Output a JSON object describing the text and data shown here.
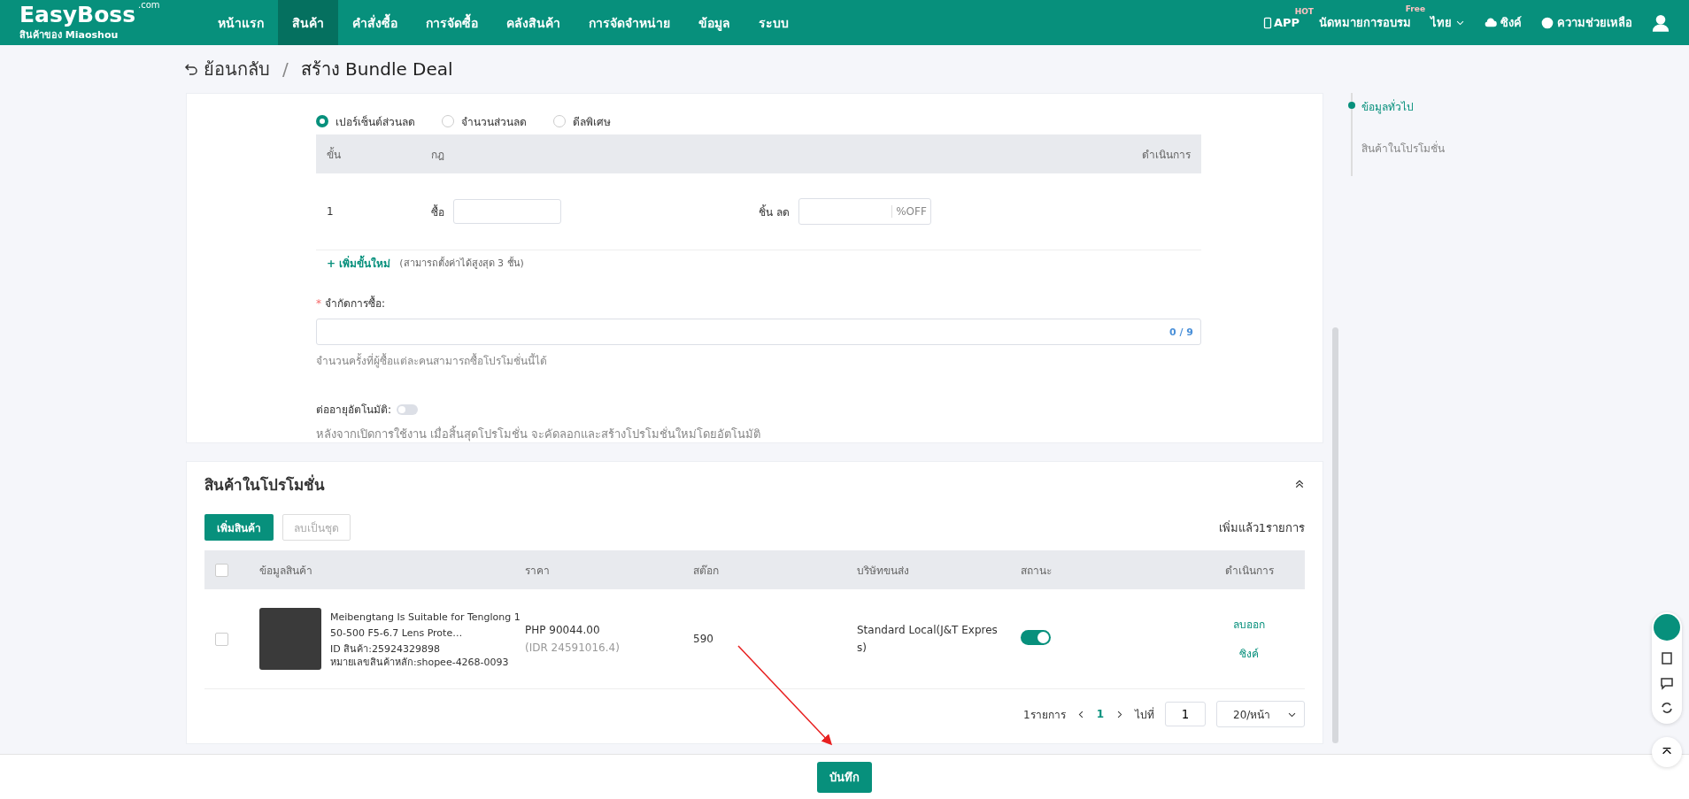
{
  "header": {
    "logo": {
      "name": "EasyBoss",
      "suffix": ".com",
      "tagline": "สินค้าของ Miaoshou"
    },
    "nav": [
      {
        "label": "หน้าแรก",
        "selected": false
      },
      {
        "label": "สินค้า",
        "selected": true
      },
      {
        "label": "คำสั่งซื้อ",
        "selected": false
      },
      {
        "label": "การจัดซื้อ",
        "selected": false
      },
      {
        "label": "คลังสินค้า",
        "selected": false
      },
      {
        "label": "การจัดจำหน่าย",
        "selected": false
      },
      {
        "label": "ข้อมูล",
        "selected": false
      },
      {
        "label": "ระบบ",
        "selected": false
      }
    ],
    "app": "APP",
    "app_badge": "HOT",
    "training": "นัดหมายการอบรม",
    "training_badge": "Free",
    "language": "ไทย",
    "sync": "ซิงค์",
    "help": "ความช่วยเหลือ"
  },
  "breadcrumb": {
    "back": "ย้อนกลับ",
    "separator": "/",
    "title": "สร้าง Bundle Deal"
  },
  "promo_type": {
    "options": [
      {
        "label": "เปอร์เซ็นต์ส่วนลด",
        "selected": true
      },
      {
        "label": "จำนวนส่วนลด",
        "selected": false
      },
      {
        "label": "ดีลพิเศษ",
        "selected": false
      }
    ]
  },
  "tiers": {
    "columns": [
      "ขั้น",
      "กฎ",
      "ดำเนินการ"
    ],
    "rows": [
      {
        "tier": "1",
        "buy_label": "ซื้อ",
        "discount_label": "ชิ้น ลด",
        "suffix": "%OFF"
      }
    ],
    "add": "+ เพิ่มขั้นใหม่",
    "add_note": "(สามารถตั้งค่าได้สูงสุด 3 ชั้น)"
  },
  "purchase_limit": {
    "label": "จำกัดการซื้อ:",
    "required_mark": "*",
    "counter": "0 / 9",
    "help": "จำนวนครั้งที่ผู้ซื้อแต่ละคนสามารถซื้อโปรโมชั่นนี้ได้"
  },
  "auto_renew": {
    "label": "ต่ออายุอัตโนมัติ:",
    "on": false,
    "help": "หลังจากเปิดการใช้งาน เมื่อสิ้นสุดโปรโมชั่น จะคัดลอกและสร้างโปรโมชั่นใหม่โดยอัตโนมัติ"
  },
  "products": {
    "title": "สินค้าในโปรโมชั่น",
    "add_button": "เพิ่มสินค้า",
    "bulk_delete": "ลบเป็นชุด",
    "count": "เพิ่มแล้ว1รายการ",
    "columns": [
      "ข้อมูลสินค้า",
      "ราคา",
      "สต๊อก",
      "บริษัทขนส่ง",
      "สถานะ",
      "ดำเนินการ"
    ],
    "header_checked": false,
    "rows": [
      {
        "checked": false,
        "name": "Meibengtang Is Suitable for Tenglong 150-500 F5-6.7 Lens Prote…",
        "id": "ID สินค้า:25924329898",
        "sku": "หมายเลขสินค้าหลัก:shopee-4268-0093",
        "price": "PHP 90044.00",
        "price_alt": "(IDR 24591016.4)",
        "stock": "590",
        "shipping": "Standard Local(J&T Express)",
        "status_on": true,
        "actions": [
          "ลบออก",
          "ซิงค์"
        ]
      }
    ],
    "pagination": {
      "total": "1รายการ",
      "pages": [
        {
          "label": "1",
          "selected": true
        }
      ],
      "goto_label": "ไปที่",
      "goto_value": "1",
      "page_size": "20/หน้า"
    }
  },
  "anchor_nav": [
    {
      "label": "ข้อมูลทั่วไป",
      "selected": true
    },
    {
      "label": "สินค้าในโปรโมชั่น",
      "selected": false
    }
  ],
  "footer": {
    "save": "บันทึก"
  }
}
